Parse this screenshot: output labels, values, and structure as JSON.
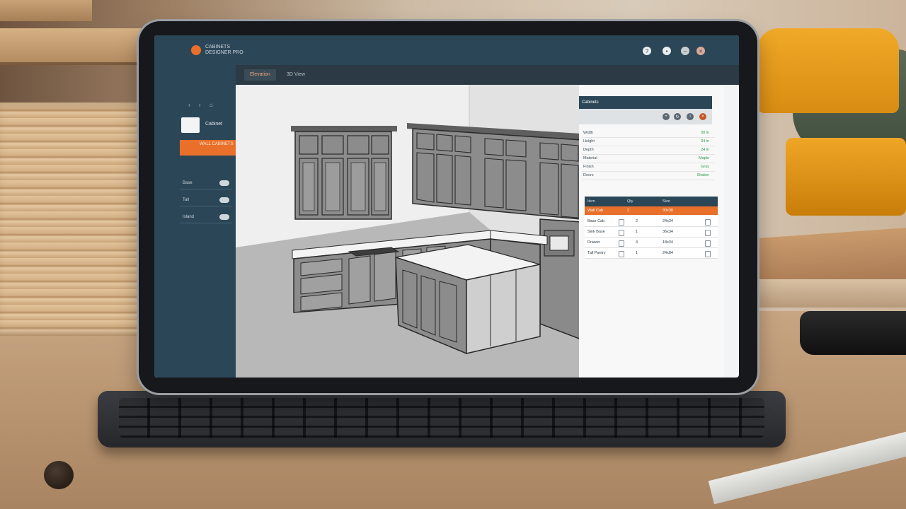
{
  "app": {
    "title_line1": "CABINETS",
    "title_line2": "DESIGNER PRO",
    "toolbar_tab": "Elevation",
    "toolbar_tab2": "3D View"
  },
  "window_buttons": [
    "help-icon",
    "settings-icon",
    "minimize-icon",
    "close-icon"
  ],
  "sidebar": {
    "nav_icons": [
      "‹",
      "›",
      "⌂"
    ],
    "thumb_label": "Cabinet",
    "active_item": "WALL CABINETS",
    "rows": [
      {
        "label": "Base"
      },
      {
        "label": "Tall"
      },
      {
        "label": "Island"
      }
    ]
  },
  "panel": {
    "header": "Cabinets",
    "properties": [
      {
        "key": "Width",
        "value": "30 in"
      },
      {
        "key": "Height",
        "value": "34 in"
      },
      {
        "key": "Depth",
        "value": "24 in"
      },
      {
        "key": "Material",
        "value": "Maple"
      },
      {
        "key": "Finish",
        "value": "Gray"
      },
      {
        "key": "Doors",
        "value": "Shaker"
      }
    ],
    "table_headers": [
      "Item",
      "Qty",
      "Size"
    ],
    "highlight_row": [
      "Wall Cab",
      "2",
      "30x30"
    ],
    "rows": [
      [
        "Base Cab",
        "2",
        "24x34"
      ],
      [
        "Sink Base",
        "1",
        "36x34"
      ],
      [
        "Drawer",
        "4",
        "18x34"
      ],
      [
        "Tall Pantry",
        "1",
        "24x84"
      ]
    ]
  },
  "colors": {
    "accent": "#e8702a",
    "dark": "#2b4657",
    "cabinet": "#8c8c8c",
    "counter": "#f2f2f2"
  }
}
